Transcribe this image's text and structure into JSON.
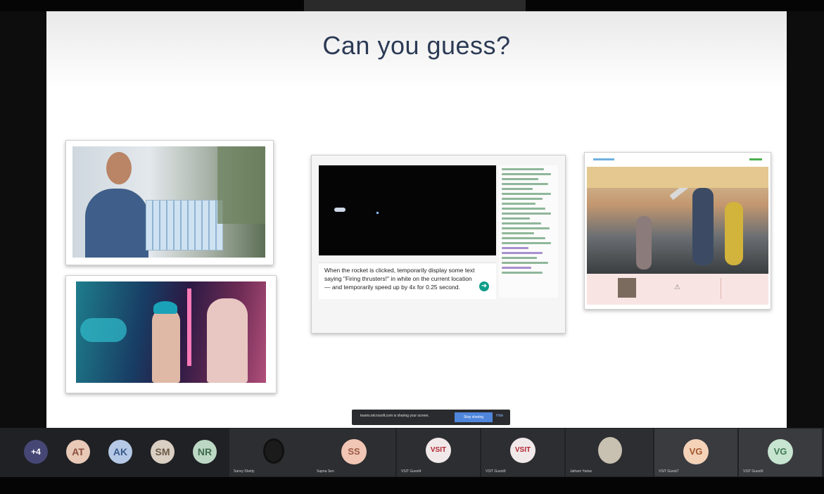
{
  "slide": {
    "title": "Can you guess?"
  },
  "code_card": {
    "prompt_text": "When the rocket is clicked, temporarily display some text saying \"Firing thrusters!\" in white on the current location — and temporarily speed up by 4x for 0.25 second."
  },
  "share_banner": {
    "text": "teams.microsoft.com is sharing your screen.",
    "stop_label": "Stop sharing",
    "hide_label": "Hide"
  },
  "participants": {
    "overflow_count": "+4",
    "avatars": [
      {
        "initials": "AT",
        "bg": "#e8c9b8"
      },
      {
        "initials": "AK",
        "bg": "#b5c9e6"
      },
      {
        "initials": "SM",
        "bg": "#d9cfc2"
      },
      {
        "initials": "NR",
        "bg": "#bcd8c4"
      }
    ],
    "tiles": [
      {
        "name": "Sanvy Shetty"
      },
      {
        "name": "Sapna Sen",
        "initials": "SS"
      },
      {
        "name": "VSIT Guest4",
        "logo": "VSIT"
      },
      {
        "name": "VSIT Guest9",
        "logo": "VSIT"
      },
      {
        "name": "Jaiham Yadav"
      },
      {
        "name": "VSIT Guest7",
        "initials": "VG"
      },
      {
        "name": "VSIT Guest9",
        "initials": "VG"
      }
    ]
  },
  "colors": {
    "bottom_bar": "#202124",
    "accent_blue": "#4f86dc",
    "slide_title": "#2b3a55"
  }
}
